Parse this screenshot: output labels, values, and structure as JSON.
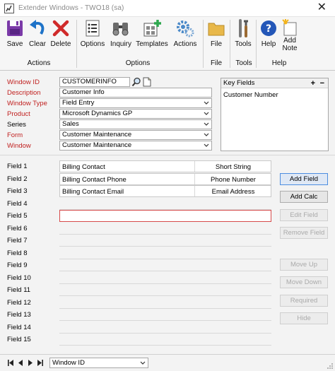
{
  "window": {
    "title": "Extender Windows  -  TWO18 (sa)",
    "close_glyph": "✕"
  },
  "ribbon": {
    "buttons": {
      "save": "Save",
      "clear": "Clear",
      "delete": "Delete",
      "options": "Options",
      "inquiry": "Inquiry",
      "templates": "Templates",
      "actions": "Actions",
      "file": "File",
      "tools": "Tools",
      "help": "Help",
      "add_note": "Add\nNote"
    },
    "groups": {
      "actions": "Actions",
      "options": "Options",
      "file": "File",
      "tools": "Tools",
      "help": "Help"
    },
    "colors": {
      "save": "#7b3aa8",
      "clear": "#1e73c8",
      "delete": "#d02a2a",
      "help": "#2457b8"
    }
  },
  "form": {
    "labels": {
      "window_id": "Window ID",
      "description": "Description",
      "window_type": "Window Type",
      "product": "Product",
      "series": "Series",
      "form": "Form",
      "window": "Window"
    },
    "values": {
      "window_id": "CUSTOMERINFO",
      "description": "Customer Info",
      "window_type": "Field Entry",
      "product": "Microsoft Dynamics GP",
      "series": "Sales",
      "form": "Customer Maintenance",
      "window": "Customer Maintenance"
    },
    "key_fields": {
      "header": "Key Fields",
      "plus": "+",
      "minus": "−",
      "items": [
        "Customer Number"
      ]
    }
  },
  "fields": [
    {
      "label": "Field 1",
      "name": "Billing Contact",
      "type": "Short String"
    },
    {
      "label": "Field 2",
      "name": "Billing Contact Phone",
      "type": "Phone Number"
    },
    {
      "label": "Field 3",
      "name": "Billing Contact Email",
      "type": "Email Address"
    },
    {
      "label": "Field 4",
      "name": "",
      "type": ""
    },
    {
      "label": "Field 5",
      "name": "",
      "type": ""
    },
    {
      "label": "Field 6",
      "name": "",
      "type": ""
    },
    {
      "label": "Field 7",
      "name": "",
      "type": ""
    },
    {
      "label": "Field 8",
      "name": "",
      "type": ""
    },
    {
      "label": "Field 9",
      "name": "",
      "type": ""
    },
    {
      "label": "Field 10",
      "name": "",
      "type": ""
    },
    {
      "label": "Field 11",
      "name": "",
      "type": ""
    },
    {
      "label": "Field 12",
      "name": "",
      "type": ""
    },
    {
      "label": "Field 13",
      "name": "",
      "type": ""
    },
    {
      "label": "Field 14",
      "name": "",
      "type": ""
    },
    {
      "label": "Field 15",
      "name": "",
      "type": ""
    }
  ],
  "side_buttons": {
    "add_field": "Add Field",
    "add_calc": "Add Calc",
    "edit_field": "Edit Field",
    "remove_field": "Remove Field",
    "move_up": "Move Up",
    "move_down": "Move Down",
    "required": "Required",
    "hide": "Hide"
  },
  "bottom": {
    "browse_by": "Window ID"
  }
}
